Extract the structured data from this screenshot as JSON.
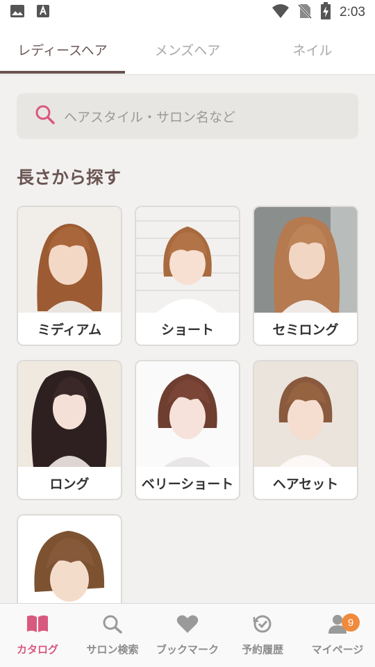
{
  "status_bar": {
    "time": "2:03"
  },
  "tabs": [
    {
      "label": "レディースヘア",
      "active": true
    },
    {
      "label": "メンズヘア",
      "active": false
    },
    {
      "label": "ネイル",
      "active": false
    }
  ],
  "search": {
    "placeholder": "ヘアスタイル・サロン名など"
  },
  "section": {
    "title": "長さから探す"
  },
  "styles": [
    {
      "label": "ミディアム"
    },
    {
      "label": "ショート"
    },
    {
      "label": "セミロング"
    },
    {
      "label": "ロング"
    },
    {
      "label": "ベリーショート"
    },
    {
      "label": "ヘアセット"
    },
    {
      "label": ""
    }
  ],
  "bottom_nav": [
    {
      "label": "カタログ",
      "icon": "book-icon",
      "active": true
    },
    {
      "label": "サロン検索",
      "icon": "search-icon",
      "active": false
    },
    {
      "label": "ブックマーク",
      "icon": "heart-icon",
      "active": false
    },
    {
      "label": "予約履歴",
      "icon": "history-icon",
      "active": false
    },
    {
      "label": "マイページ",
      "icon": "user-icon",
      "active": false,
      "badge": "9"
    }
  ],
  "colors": {
    "accent": "#d9587f",
    "title": "#6a5553",
    "badge": "#f08a3c"
  }
}
